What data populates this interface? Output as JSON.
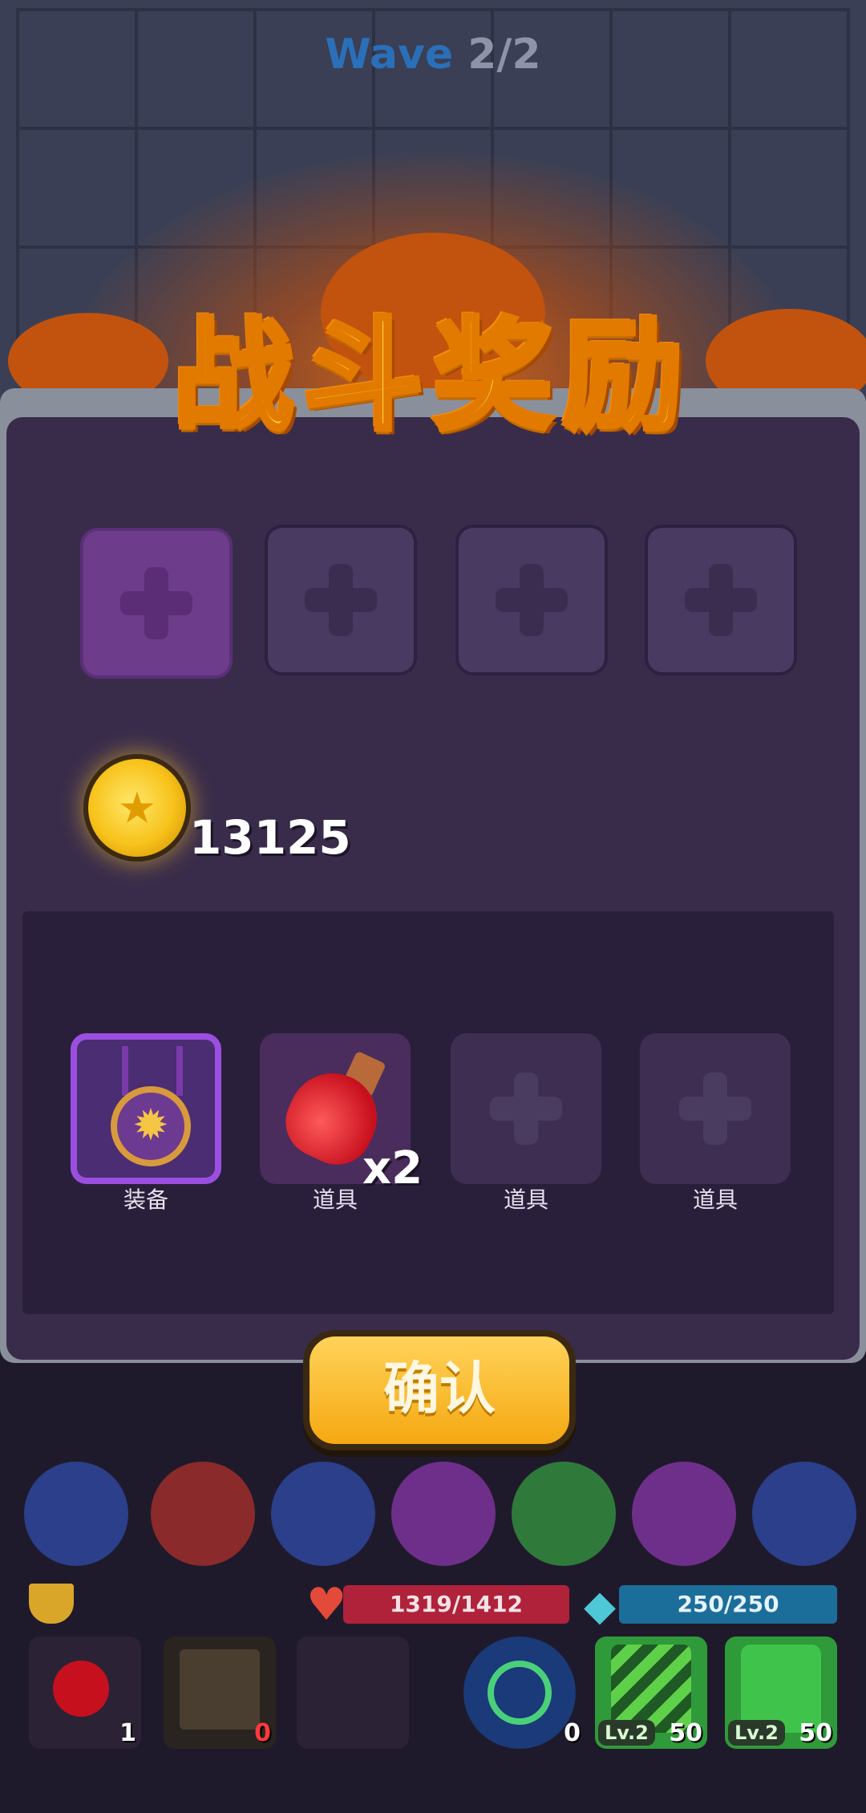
{
  "wave": {
    "label": "Wave",
    "count": "2/2"
  },
  "title": "战斗奖励",
  "top_slots": [
    {
      "id": 1,
      "state": "empty"
    },
    {
      "id": 2,
      "state": "empty"
    },
    {
      "id": 3,
      "state": "empty"
    },
    {
      "id": 4,
      "state": "empty"
    }
  ],
  "coins": {
    "amount": "13125",
    "icon": "gold-coin-icon"
  },
  "items": [
    {
      "label": "装备",
      "icon": "medal-icon",
      "quantity": ""
    },
    {
      "label": "道具",
      "icon": "red-potion-icon",
      "quantity": "x2"
    },
    {
      "label": "道具",
      "icon": "plus-icon",
      "quantity": ""
    },
    {
      "label": "道具",
      "icon": "plus-icon",
      "quantity": ""
    }
  ],
  "confirm_label": "确认",
  "hud": {
    "hp": "1319/1412",
    "mana": "250/250"
  },
  "skills": [
    {
      "icon": "red-potion-icon",
      "count": "1",
      "level": ""
    },
    {
      "icon": "scroll-map-icon",
      "count": "0",
      "level": ""
    },
    {
      "icon": "empty-slot",
      "count": "",
      "level": ""
    },
    {
      "icon": "target-crosshair-icon",
      "count": "0",
      "level": ""
    },
    {
      "icon": "green-slash-icon",
      "count": "50",
      "level": "Lv.2"
    },
    {
      "icon": "green-armor-icon",
      "count": "50",
      "level": "Lv.2"
    }
  ],
  "colors": {
    "title_gold": "#ffd43a",
    "panel_purple": "#392c4b",
    "confirm_yellow": "#f5a812",
    "hp_red": "#b0223a",
    "mana_blue": "#1c6e9a",
    "equip_border": "#9b4fe0"
  }
}
